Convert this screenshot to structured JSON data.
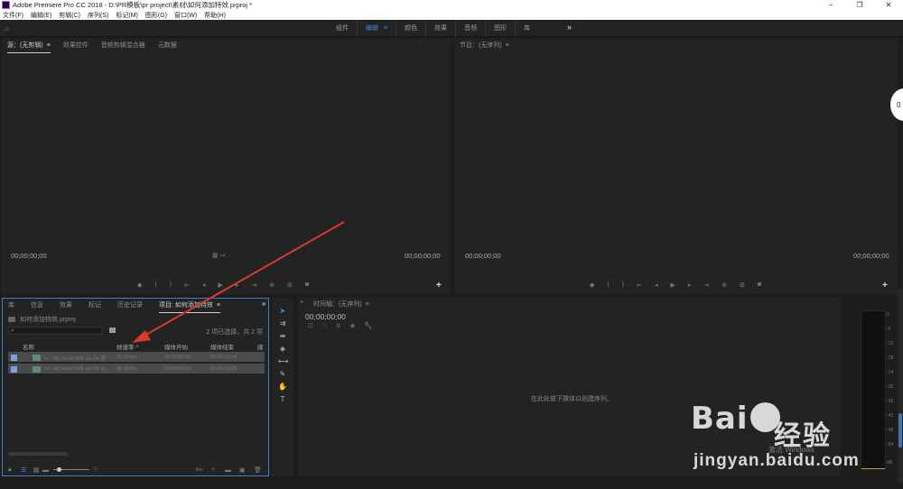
{
  "window": {
    "title": "Adobe Premiere Pro CC 2018 - D:\\PR模板\\pr project\\素材\\如何添加特效.prproj *",
    "controls": [
      "−",
      "❐",
      "✕"
    ]
  },
  "menu": [
    "文件(F)",
    "编辑(E)",
    "剪辑(C)",
    "序列(S)",
    "标记(M)",
    "图形(G)",
    "窗口(W)",
    "帮助(H)"
  ],
  "workspaces": {
    "tabs": [
      "组件",
      "编辑",
      "颜色",
      "效果",
      "音频",
      "图形",
      "库"
    ],
    "active": "编辑",
    "more": "»"
  },
  "source_panel": {
    "tabs": [
      "源：(无剪辑)",
      "效果控件",
      "音频剪辑混合器",
      "元数据"
    ],
    "timecode_left": "00;00;00;00",
    "timecode_right": "00;00;00;00",
    "add_button": "+"
  },
  "program_panel": {
    "tabs": [
      "节目：(无序列)"
    ],
    "timecode_left": "00;00;00;00",
    "timecode_right": "00;00;00;00",
    "add_button": "+"
  },
  "project_panel": {
    "tabs": [
      "库",
      "信息",
      "效果",
      "标记",
      "历史记录",
      "项目: 如何添加特效"
    ],
    "active_tab": "项目: 如何添加特效",
    "more": "»",
    "file_name": "如何添加特效.prproj",
    "search_placeholder": "",
    "selection_info": "2 项已选择，共 2 项",
    "columns": [
      "名称",
      "帧速率 ^",
      "媒体开始",
      "媒体结束",
      "媒"
    ],
    "rows": [
      {
        "name": "hc - My Heart Will Go On 原",
        "fps": "25.00 fps",
        "start": "00:00:00:00",
        "end": "00:05:10:24"
      },
      {
        "name": "hc - My Heart Will Go On (p",
        "fps": "30.00 fps",
        "start": "00:00:00:00",
        "end": "00:05:10:29"
      }
    ],
    "bottom": {
      "bin_label": "Bin"
    }
  },
  "timeline_panel": {
    "title": "时间轴：(无序列)",
    "timecode": "00;00;00;00",
    "empty_message": "在此处放下媒体以创建序列。"
  },
  "audio_meter": {
    "scale": [
      "0",
      "-6",
      "-12",
      "-18",
      "-24",
      "-30",
      "-36",
      "-42",
      "-48",
      "-54",
      "dB"
    ]
  },
  "watermark": {
    "logo": "Bai du",
    "text": "经验",
    "url": "jingyan.baidu.com",
    "activation": "激活 Windows"
  },
  "overlay_bubble": "0",
  "colors": {
    "accent_blue": "#3f8ae0",
    "arrow_red": "#d63a2f",
    "panel_bg": "#232323",
    "app_bg": "#1d1d1d"
  }
}
